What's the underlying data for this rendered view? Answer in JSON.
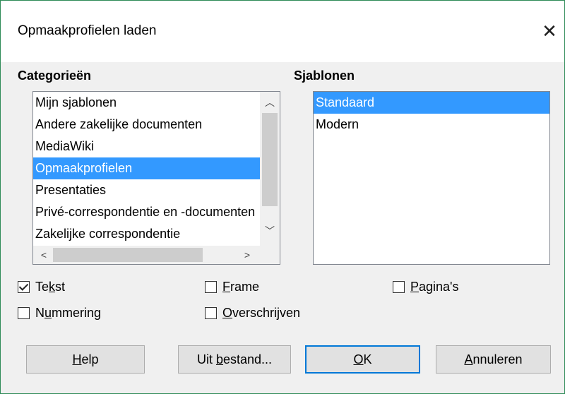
{
  "dialog": {
    "title": "Opmaakprofielen laden",
    "close_glyph": "✕"
  },
  "categories": {
    "label": "Categorieën",
    "items": [
      "Mijn sjablonen",
      "Andere zakelijke documenten",
      "MediaWiki",
      "Opmaakprofielen",
      "Presentaties",
      "Privé-correspondentie en -documenten",
      "Zakelijke correspondentie"
    ],
    "selected_index": 3
  },
  "templates": {
    "label": "Sjablonen",
    "items": [
      "Standaard",
      "Modern"
    ],
    "selected_index": 0
  },
  "options": {
    "text": {
      "label_pre": "Te",
      "label_u": "k",
      "label_post": "st",
      "checked": true
    },
    "frame": {
      "label_pre": "",
      "label_u": "F",
      "label_post": "rame",
      "checked": false
    },
    "pages": {
      "label_pre": "",
      "label_u": "P",
      "label_post": "agina's",
      "checked": false
    },
    "numbering": {
      "label_pre": "N",
      "label_u": "u",
      "label_post": "mmering",
      "checked": false
    },
    "overwrite": {
      "label_pre": "",
      "label_u": "O",
      "label_post": "verschrijven",
      "checked": false
    }
  },
  "buttons": {
    "help": {
      "pre": "",
      "u": "H",
      "post": "elp"
    },
    "from_file": {
      "pre": "Uit ",
      "u": "b",
      "post": "estand..."
    },
    "ok": {
      "pre": "",
      "u": "O",
      "post": "K"
    },
    "cancel": {
      "pre": "",
      "u": "A",
      "post": "nnuleren"
    }
  },
  "icons": {
    "scroll_up": "chevron-up-icon",
    "scroll_down": "chevron-down-icon",
    "scroll_left": "chevron-left-icon",
    "scroll_right": "chevron-right-icon",
    "checkmark": "checkmark-icon"
  },
  "colors": {
    "selection": "#3399ff",
    "default_button_border": "#0078d7",
    "window_border": "#2e8b57"
  }
}
